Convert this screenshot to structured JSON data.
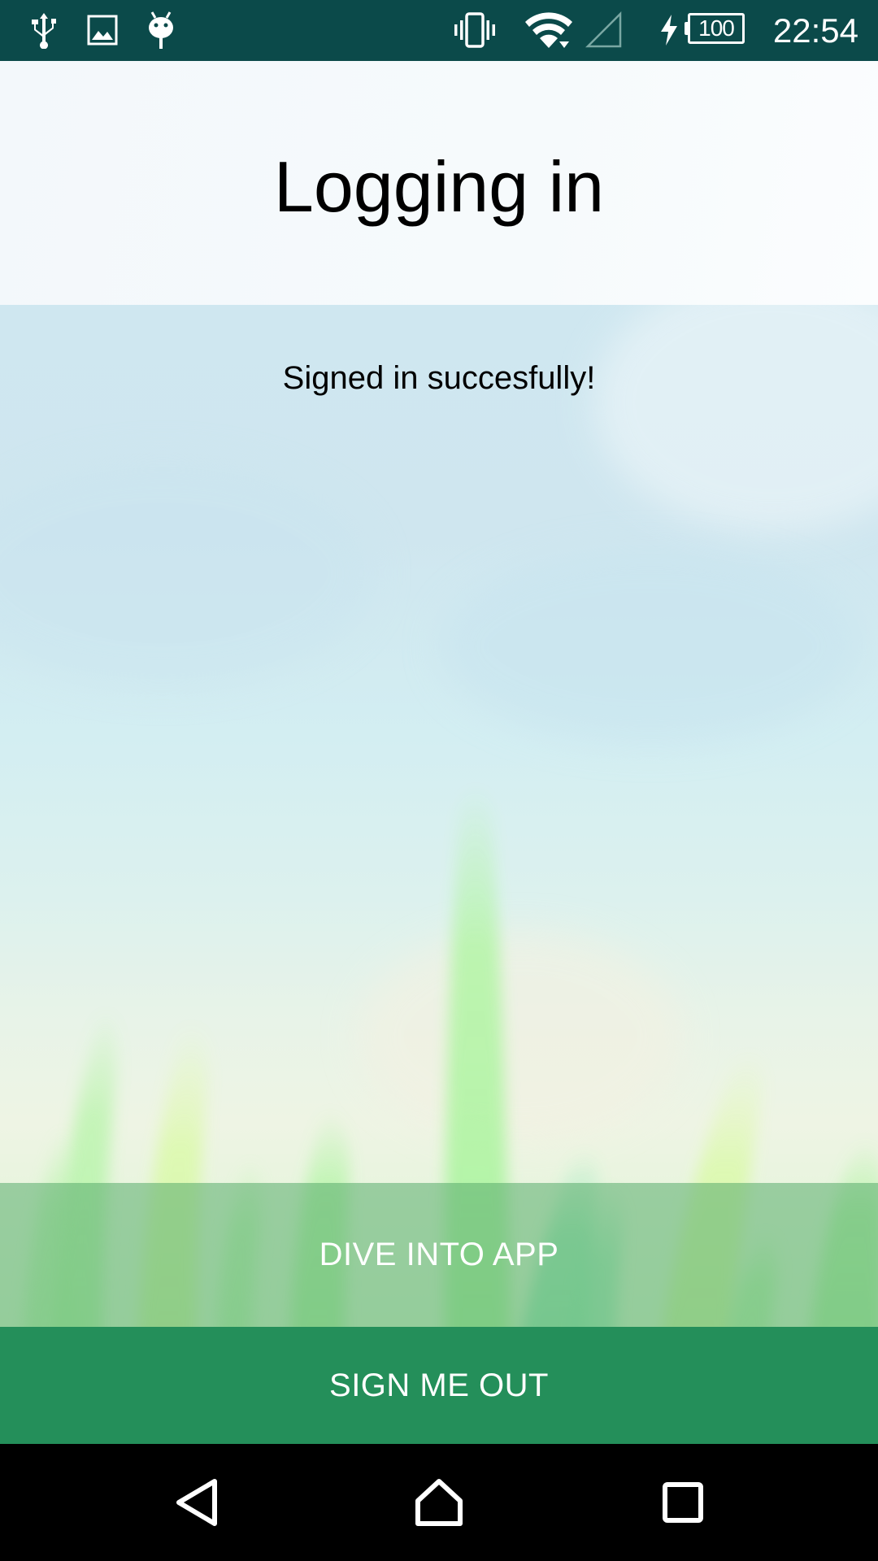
{
  "status_bar": {
    "icons": [
      "usb-icon",
      "image-icon",
      "android-debug-icon",
      "vibrate-icon",
      "wifi-icon",
      "cell-signal-icon",
      "charging-icon"
    ],
    "battery_level": "100",
    "time": "22:54"
  },
  "header": {
    "title": "Logging in"
  },
  "main": {
    "message": "Signed in succesfully!"
  },
  "actions": {
    "dive_label": "DIVE INTO APP",
    "signout_label": "SIGN ME OUT"
  },
  "nav_bar": {
    "icons": [
      "back-icon",
      "home-icon",
      "recents-icon"
    ]
  },
  "colors": {
    "status_bar": "#0b4a4a",
    "signout_button": "#248f5a",
    "dive_button_overlay": "#58ac6c"
  }
}
